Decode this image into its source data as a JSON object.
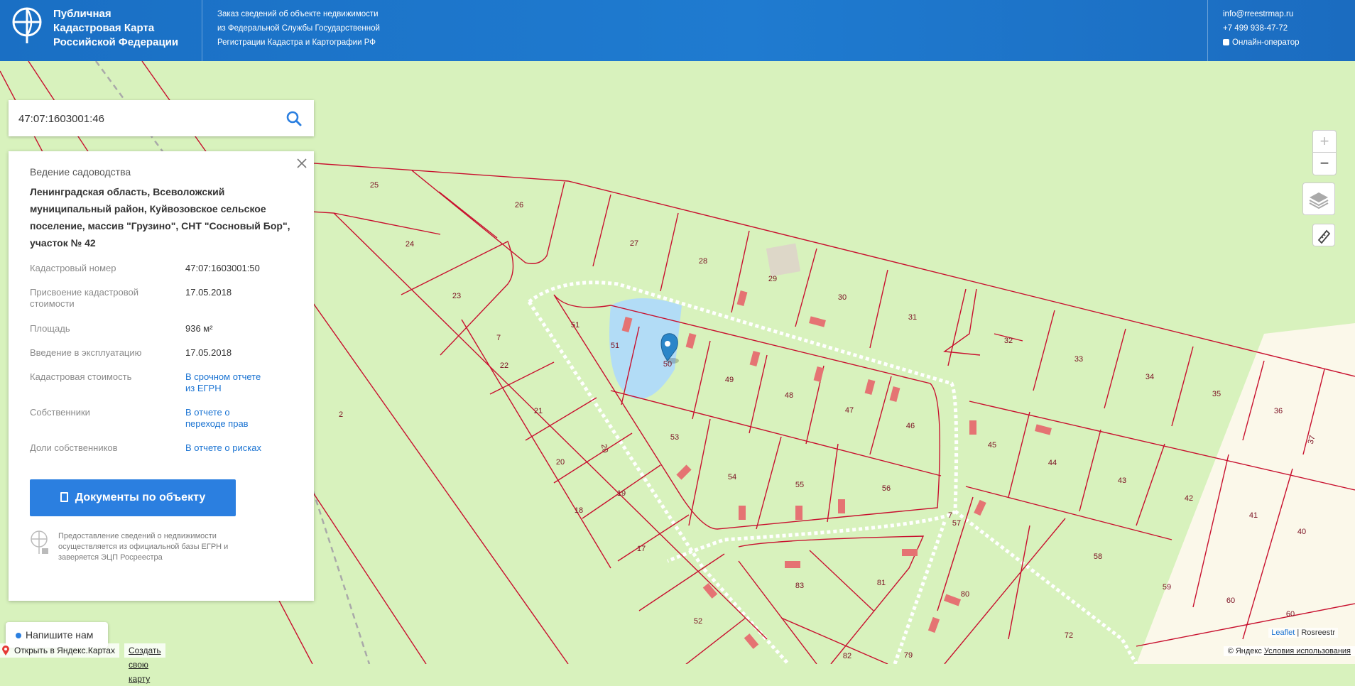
{
  "header": {
    "brand_line1": "Публичная",
    "brand_line2": "Кадастровая Карта",
    "brand_line3": "Российской Федерации",
    "order_line1": "Заказ сведений об объекте недвижимости",
    "order_line2": "из Федеральной Службы Государственной",
    "order_line3": "Регистрации Кадастра и Картографии РФ",
    "email": "info@rreestrmap.ru",
    "phone": "+7 499 938-47-72",
    "online": "Онлайн-оператор"
  },
  "search": {
    "value": "47:07:1603001:46",
    "icon": "search-icon"
  },
  "card": {
    "type": "Ведение садоводства",
    "address": "Ленинградская область, Всеволожский муниципальный район, Куйвозовское сельское поселение, массив \"Грузино\", СНТ \"Сосновый Бор\", участок № 42",
    "rows": [
      {
        "key": "Кадастровый номер",
        "value": "47:07:1603001:50"
      },
      {
        "key": "Присвоение кадастровой стоимости",
        "value": "17.05.2018"
      },
      {
        "key": "Площадь",
        "value": "936 м²"
      },
      {
        "key": "Введение в эксплуатацию",
        "value": "17.05.2018"
      },
      {
        "key": "Кадастровая стоимость",
        "value": "В срочном отчете из ЕГРН"
      },
      {
        "key": "Собственники",
        "value": "В отчете о переходе прав"
      },
      {
        "key": "Доли собственников",
        "value": "В отчете о рисках"
      }
    ],
    "doc_button": "Документы по объекту",
    "note": "Предоставление сведений о недвижимости осуществляется из официальной базы ЕГРН и заверяется ЭЦП Росреестра"
  },
  "map": {
    "plot_labels": [
      "25",
      "26",
      "24",
      "23",
      "27",
      "28",
      "29",
      "30",
      "31",
      "32",
      "33",
      "34",
      "35",
      "36",
      "37",
      "51",
      "51",
      "50",
      "49",
      "48",
      "47",
      "46",
      "45",
      "44",
      "43",
      "42",
      "41",
      "40",
      "7",
      "22",
      "21",
      "20",
      "20",
      "19",
      "18",
      "17",
      "52",
      "53",
      "54",
      "55",
      "56",
      "57",
      "58",
      "59",
      "60",
      "60",
      "83",
      "81",
      "80",
      "72",
      "79",
      "82",
      "2",
      "7"
    ],
    "controls": {
      "zoom_in": "+",
      "zoom_out": "−"
    }
  },
  "chat": {
    "label": "Напишите нам"
  },
  "attribution": {
    "leaflet": "Leaflet",
    "rosreestr": "Rosreestr",
    "yandex_open": "Открыть в Яндекс.Картах",
    "yandex_create": "Создать свою карту",
    "yandex_copy": "© Яндекс",
    "yandex_terms": "Условия использования"
  },
  "colors": {
    "header": "#1f7bd0",
    "map_green": "#d8f2bd",
    "parcel_line": "#c8102e",
    "accent": "#2b7fe0"
  }
}
